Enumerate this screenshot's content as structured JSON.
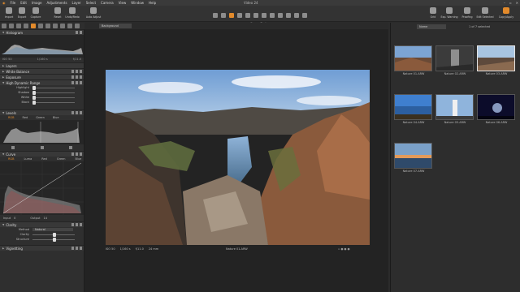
{
  "menubar": {
    "items": [
      "File",
      "Edit",
      "Image",
      "Adjustments",
      "Layer",
      "Select",
      "Camera",
      "View",
      "Window",
      "Help"
    ],
    "title": "Video 24"
  },
  "toolbar": {
    "left": [
      "Import",
      "Export",
      "Capture"
    ],
    "mid": [
      "Reset",
      "Undo/Redo",
      "Auto Adjust"
    ],
    "right": [
      "Grid",
      "Exp. Warning",
      "Proofing",
      "Edit Selected",
      "Copy/Apply"
    ],
    "cursor_label": "Cursor Tools"
  },
  "viewer": {
    "background_dropdown": "Background",
    "iso": "ISO 50",
    "shutter": "1/160 s",
    "aperture": "f/11.0",
    "focal": "24 mm",
    "filename": "Nature 01.ARW"
  },
  "browser": {
    "filter": "Name",
    "count": "1 of 7 selected",
    "thumbs": [
      "Nature 01.ARW",
      "Nature 02.ARW",
      "Nature 03.ARW",
      "Nature 04.ARW",
      "Nature 05.ARW",
      "Nature 06.ARW",
      "Nature 07.ARW"
    ]
  },
  "left": {
    "histogram": "Histogram",
    "hist_iso": "ISO 50",
    "hist_shutter": "1/160 s",
    "hist_ap": "f/11.0",
    "layers": "Layers",
    "white_balance": "White Balance",
    "exposure": "Exposure",
    "hdr": "High Dynamic Range",
    "hdr_sliders": [
      "Highlight",
      "Shadow",
      "White",
      "Black"
    ],
    "levels": "Levels",
    "levels_tabs": [
      "RGB",
      "Red",
      "Green",
      "Blue"
    ],
    "curve": "Curve",
    "curve_tabs": [
      "RGB",
      "Luma",
      "Red",
      "Green",
      "Blue"
    ],
    "input_label": "Input",
    "input_val": "0",
    "output_label": "Output",
    "output_val": "14",
    "clarity": "Clarity",
    "method_label": "Method",
    "method_val": "Natural",
    "clarity_sliders": [
      "Clarity",
      "Structure"
    ],
    "vignetting": "Vignetting"
  }
}
